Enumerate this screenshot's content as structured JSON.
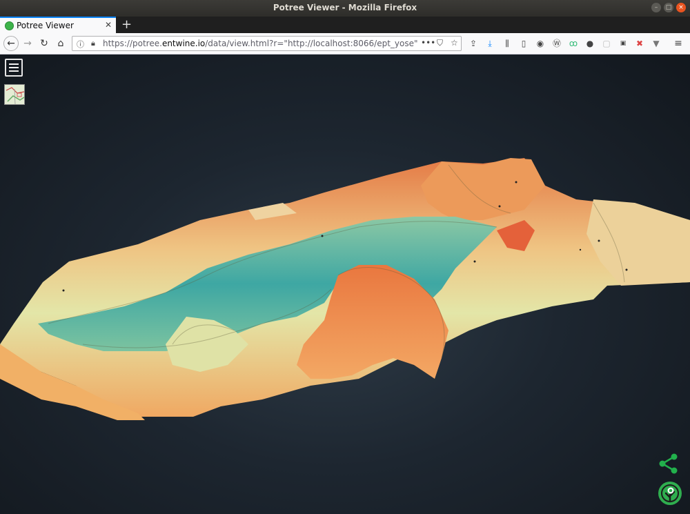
{
  "window": {
    "title": "Potree Viewer - Mozilla Firefox",
    "controls": [
      "minimize-icon",
      "maximize-icon",
      "close-icon"
    ]
  },
  "tabs": [
    {
      "label": "Potree Viewer",
      "icon": "potree-favicon",
      "active": true
    }
  ],
  "navbar": {
    "url_domain_pre": "https://potree.",
    "url_domain": "entwine.io",
    "url_path": "/data/view.html?r=\"http://localhost:8066/ept_yose\"",
    "toolbar_icons": [
      "pocket-icon",
      "download-icon",
      "library-icon",
      "sidebar-icon",
      "extension-icon",
      "wordpress-icon",
      "glasses-icon",
      "account-icon",
      "screenshot-icon",
      "so-extension-icon",
      "close-extension-icon",
      "vue-devtools-icon",
      "hamburger-menu-icon"
    ]
  },
  "viewer": {
    "scene": "point-cloud-terrain",
    "colors": {
      "background": "#1b232c",
      "low": "#3aa3a0",
      "mid": "#d9e3a0",
      "high": "#e36a3c"
    },
    "menu_icon": "hamburger-icon",
    "minimap_icon": "map-thumbnail-icon",
    "share_icon": "share-icon",
    "logo_icon": "potree-logo-icon"
  }
}
